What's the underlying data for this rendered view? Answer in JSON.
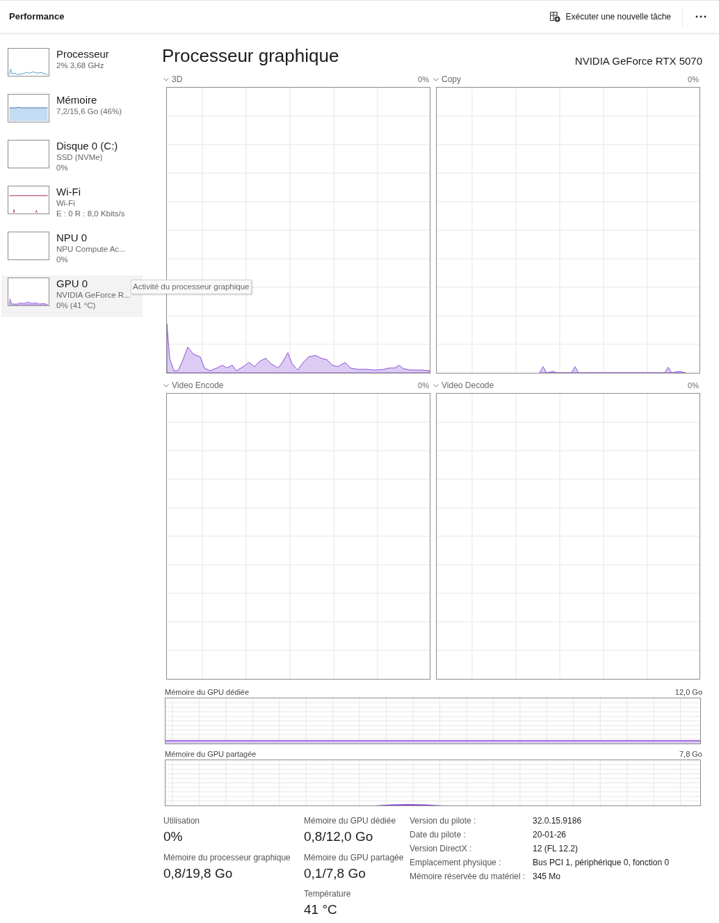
{
  "header": {
    "title": "Performance",
    "run_task_button": "Exécuter une nouvelle tâche"
  },
  "sidebar": {
    "items": [
      {
        "kind": "cpu",
        "name": "Processeur",
        "lines": [
          "2% 3,68 GHz"
        ],
        "selected": false
      },
      {
        "kind": "memory",
        "name": "Mémoire",
        "lines": [
          "7,2/15,6 Go (46%)"
        ],
        "selected": false
      },
      {
        "kind": "disk",
        "name": "Disque 0 (C:)",
        "lines": [
          "SSD (NVMe)",
          "0%"
        ],
        "selected": false
      },
      {
        "kind": "wifi",
        "name": "Wi-Fi",
        "lines": [
          "Wi-Fi",
          "E : 0 R : 8,0 Kbits/s"
        ],
        "selected": false
      },
      {
        "kind": "npu",
        "name": "NPU 0",
        "lines": [
          "NPU Compute Ac...",
          "0%"
        ],
        "selected": false
      },
      {
        "kind": "gpu",
        "name": "GPU 0",
        "lines": [
          "NVIDIA GeForce R...",
          "0% (41 °C)"
        ],
        "selected": true
      }
    ]
  },
  "tooltip": "Activité du processeur graphique",
  "main": {
    "title": "Processeur graphique",
    "device": "NVIDIA GeForce RTX 5070",
    "engines": [
      {
        "kind": "busy",
        "label": "3D",
        "reading": "0%"
      },
      {
        "kind": "copy",
        "label": "Copy",
        "reading": "0%"
      },
      {
        "kind": "flat",
        "label": "Video Encode",
        "reading": "0%"
      },
      {
        "kind": "flat",
        "label": "Video Decode",
        "reading": "0%"
      }
    ],
    "memory_charts": [
      {
        "kind": "dedicated",
        "label": "Mémoire du GPU dédiée",
        "max": "12,0 Go"
      },
      {
        "kind": "shared",
        "label": "Mémoire du GPU partagée",
        "max": "7,8 Go"
      }
    ],
    "stats": [
      [
        {
          "label": "Utilisation",
          "value": "0%"
        },
        {
          "label": "Mémoire du processeur graphique",
          "value": "0,8/19,8 Go"
        }
      ],
      [
        {
          "label": "Mémoire du GPU dédiée",
          "value": "0,8/12,0 Go"
        },
        {
          "label": "Mémoire du GPU partagée",
          "value": "0,1/7,8 Go"
        },
        {
          "label": "Température",
          "value": "41 °C"
        }
      ]
    ],
    "details": [
      {
        "label": "Version du pilote :",
        "value": "32.0.15.9186"
      },
      {
        "label": "Date du pilote :",
        "value": "20-01-26"
      },
      {
        "label": "Version DirectX :",
        "value": "12 (FL 12.2)"
      },
      {
        "label": "Emplacement physique :",
        "value": "Bus PCI 1, périphérique 0, fonction 0"
      },
      {
        "label": "Mémoire réservée du matériel :",
        "value": "345 Mo"
      }
    ]
  }
}
